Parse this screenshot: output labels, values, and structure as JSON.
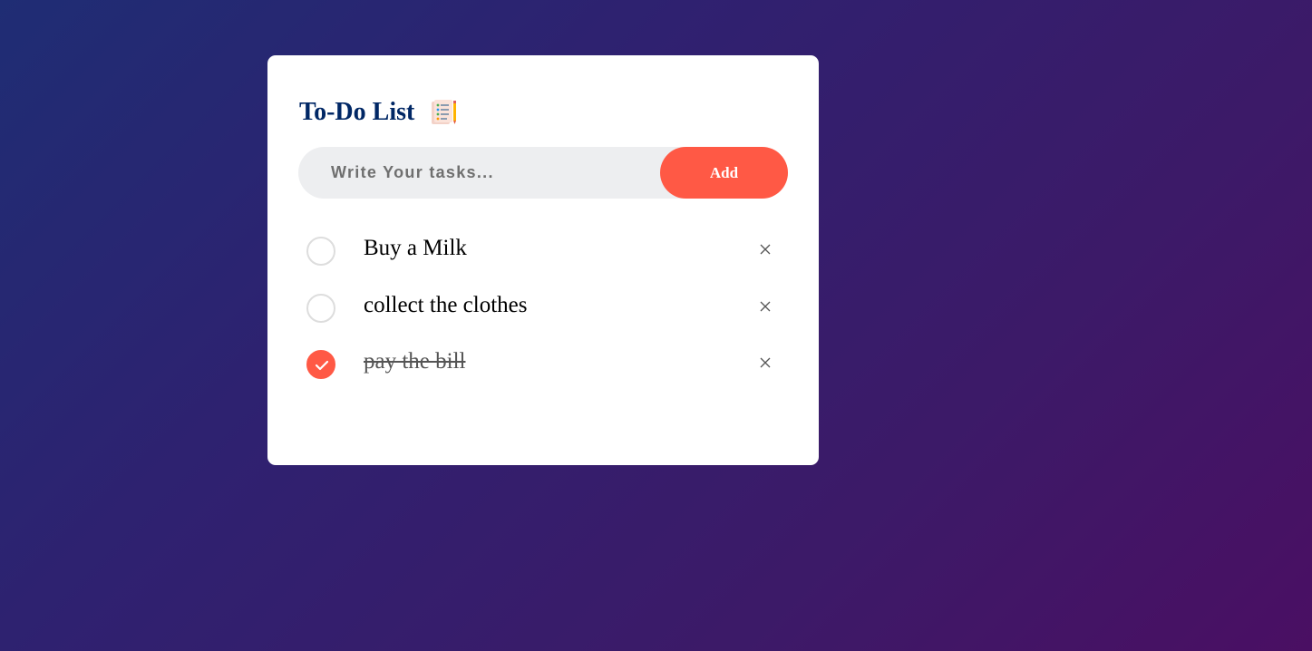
{
  "app": {
    "title": "To-Do List",
    "title_icon": "checklist-notepad-icon"
  },
  "input": {
    "placeholder": "Write Your tasks...",
    "value": ""
  },
  "add_button": {
    "label": "Add"
  },
  "tasks": [
    {
      "label": "Buy a Milk",
      "checked": false
    },
    {
      "label": "collect the clothes",
      "checked": false
    },
    {
      "label": "pay the bill",
      "checked": true
    }
  ],
  "remove_icon": "close-icon",
  "colors": {
    "accent": "#ff5945",
    "title": "#002765",
    "input_bg": "#edeef0",
    "background_start": "#1f2d74",
    "background_end": "#4a0f63"
  }
}
